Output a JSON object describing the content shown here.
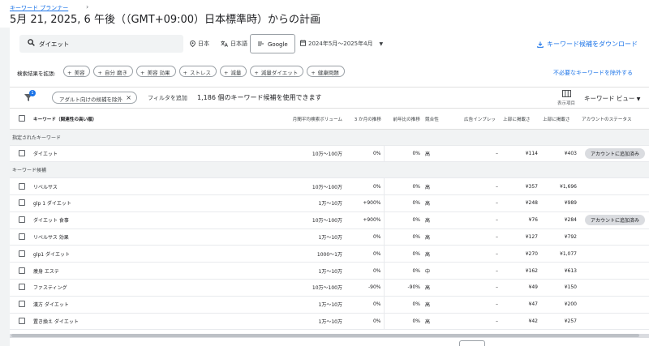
{
  "header": {
    "breadcrumb": "キーワード プランナー",
    "title": "5月 21, 2025, 6 午後（（GMT+09:00）日本標準時）からの計画"
  },
  "search": {
    "keyword": "ダイエット",
    "location": "日本",
    "language": "日本語",
    "engine": "Google",
    "date_range": "2024年5月～2025年4月",
    "download": "キーワード候補をダウンロード"
  },
  "expand": {
    "label": "検索結果を拡張:",
    "chips": [
      "美容",
      "自分 磨き",
      "美容 効果",
      "ストレス",
      "減量",
      "減量ダイエット",
      "健康問題"
    ],
    "exclude_link": "不必要なキーワードを除外する"
  },
  "filters": {
    "badge": "1",
    "adult_chip": "アダルト向けの候補を除外",
    "add_filter": "フィルタを追加",
    "using_text": "1,186 個のキーワード候補を使用できます",
    "columns_label": "表示項目",
    "view_label": "キーワード ビュー"
  },
  "table": {
    "columns": [
      "キーワード（関連性の高い順）",
      "月間平均検索ボリューム",
      "3 か月の推移",
      "前年比の推移",
      "競合性",
      "広告インプレッ",
      "上部に掲載さ",
      "上部に掲載さ",
      "アカウントのステータス"
    ],
    "group_specified": "指定されたキーワード",
    "group_ideas": "キーワード候補",
    "specified_rows": [
      {
        "keyword": "ダイエット",
        "volume": "10万～100万",
        "three_month": "0%",
        "yoy": "0%",
        "competition": "高",
        "impressions": "–",
        "bid_low": "¥114",
        "bid_high": "¥403",
        "status": "アカウントに追加済み"
      }
    ],
    "idea_rows": [
      {
        "keyword": "リベルサス",
        "volume": "10万～100万",
        "three_month": "0%",
        "yoy": "0%",
        "competition": "高",
        "impressions": "–",
        "bid_low": "¥357",
        "bid_high": "¥1,696",
        "status": ""
      },
      {
        "keyword": "glp 1 ダイエット",
        "volume": "1万～10万",
        "three_month": "+900%",
        "yoy": "0%",
        "competition": "高",
        "impressions": "–",
        "bid_low": "¥248",
        "bid_high": "¥989",
        "status": ""
      },
      {
        "keyword": "ダイエット 食事",
        "volume": "10万～100万",
        "three_month": "+900%",
        "yoy": "0%",
        "competition": "高",
        "impressions": "–",
        "bid_low": "¥76",
        "bid_high": "¥284",
        "status": "アカウントに追加済み"
      },
      {
        "keyword": "リベルサス 効果",
        "volume": "1万～10万",
        "three_month": "0%",
        "yoy": "0%",
        "competition": "高",
        "impressions": "–",
        "bid_low": "¥127",
        "bid_high": "¥792",
        "status": ""
      },
      {
        "keyword": "glp1 ダイエット",
        "volume": "1000～1万",
        "three_month": "0%",
        "yoy": "0%",
        "competition": "高",
        "impressions": "–",
        "bid_low": "¥270",
        "bid_high": "¥1,077",
        "status": ""
      },
      {
        "keyword": "痩身 エステ",
        "volume": "1万～10万",
        "three_month": "0%",
        "yoy": "0%",
        "competition": "中",
        "impressions": "–",
        "bid_low": "¥162",
        "bid_high": "¥613",
        "status": ""
      },
      {
        "keyword": "ファスティング",
        "volume": "10万～100万",
        "three_month": "-90%",
        "yoy": "-90%",
        "competition": "高",
        "impressions": "–",
        "bid_low": "¥49",
        "bid_high": "¥150",
        "status": ""
      },
      {
        "keyword": "漢方 ダイエット",
        "volume": "1万～10万",
        "three_month": "0%",
        "yoy": "0%",
        "competition": "高",
        "impressions": "–",
        "bid_low": "¥47",
        "bid_high": "¥200",
        "status": ""
      },
      {
        "keyword": "置き換え ダイエット",
        "volume": "1万～10万",
        "three_month": "0%",
        "yoy": "0%",
        "competition": "高",
        "impressions": "–",
        "bid_low": "¥42",
        "bid_high": "¥257",
        "status": ""
      }
    ]
  },
  "colors": {
    "accent": "#1a73e8",
    "background": "#f1f3f4",
    "pill": "#dadce0"
  }
}
